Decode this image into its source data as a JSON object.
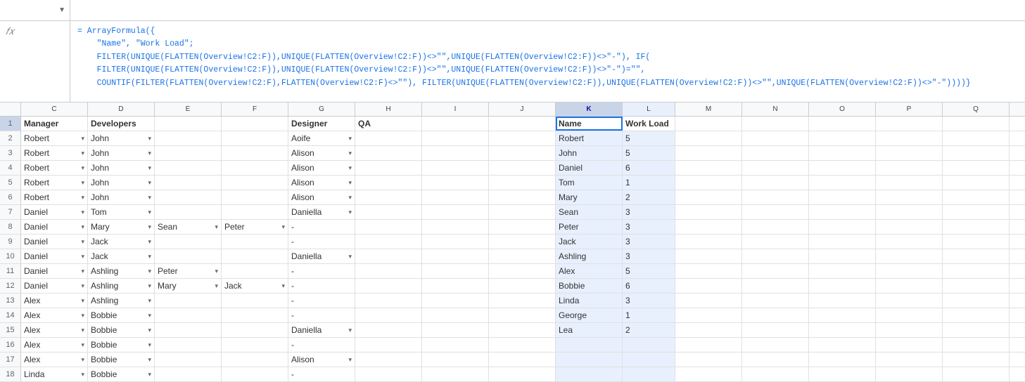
{
  "cellRef": "K1",
  "formula": "= ArrayFormula({\n    \"Name\", \"Work Load\";\n    FILTER(UNIQUE(FLATTEN(Overview!C2:F)),UNIQUE(FLATTEN(Overview!C2:F))<>\"\",UNIQUE(FLATTEN(Overview!C2:F))<>\"-\"), IF(\n    FILTER(UNIQUE(FLATTEN(Overview!C2:F)),UNIQUE(FLATTEN(Overview!C2:F))<>\"\",UNIQUE(FLATTEN(Overview!C2:F))<>\"-\")=\"\",\n    COUNTIF(FILTER(FLATTEN(Overview!C2:F),FLATTEN(Overview!C2:F)<>\"\"), FILTER(UNIQUE(FLATTEN(Overview!C2:F)),UNIQUE(FLATTEN(Overview!C2:F))<>\"\",UNIQUE(FLATTEN(Overview!C2:F))<>\"-\"))))}",
  "columns": {
    "C": "C",
    "D": "D",
    "E": "E",
    "F": "F",
    "G": "G",
    "H": "H",
    "I": "I",
    "J": "J",
    "K": "K",
    "L": "L",
    "M": "M",
    "N": "N",
    "O": "O",
    "P": "P",
    "Q": "Q"
  },
  "rows": [
    {
      "rowNum": 1,
      "c": "Manager",
      "d": "Developers",
      "e": "",
      "f": "",
      "g": "Designer",
      "h": "QA",
      "i": "",
      "j": "",
      "k": "Name",
      "l": "Work Load",
      "isHeader": true
    },
    {
      "rowNum": 2,
      "c": "Robert",
      "d": "John",
      "e": "",
      "f": "",
      "g": "Aoife",
      "h": "",
      "i": "",
      "j": "",
      "k": "Robert",
      "l": "5",
      "wlColor": "red"
    },
    {
      "rowNum": 3,
      "c": "Robert",
      "d": "John",
      "e": "",
      "f": "",
      "g": "Alison",
      "h": "",
      "i": "",
      "j": "",
      "k": "John",
      "l": "5",
      "wlColor": "red"
    },
    {
      "rowNum": 4,
      "c": "Robert",
      "d": "John",
      "e": "",
      "f": "",
      "g": "Alison",
      "h": "",
      "i": "",
      "j": "",
      "k": "Daniel",
      "l": "6",
      "wlColor": "red"
    },
    {
      "rowNum": 5,
      "c": "Robert",
      "d": "John",
      "e": "",
      "f": "",
      "g": "Alison",
      "h": "",
      "i": "",
      "j": "",
      "k": "Tom",
      "l": "1",
      "wlColor": "green"
    },
    {
      "rowNum": 6,
      "c": "Robert",
      "d": "John",
      "e": "",
      "f": "",
      "g": "Alison",
      "h": "",
      "i": "",
      "j": "",
      "k": "Mary",
      "l": "2",
      "wlColor": "light-green"
    },
    {
      "rowNum": 7,
      "c": "Daniel",
      "d": "Tom",
      "e": "",
      "f": "",
      "g": "Daniella",
      "h": "",
      "i": "",
      "j": "",
      "k": "Sean",
      "l": "3",
      "wlColor": ""
    },
    {
      "rowNum": 8,
      "c": "Daniel",
      "d": "Mary",
      "e": "Sean",
      "f": "Peter",
      "g": "-",
      "h": "",
      "i": "",
      "j": "",
      "k": "Peter",
      "l": "3",
      "wlColor": ""
    },
    {
      "rowNum": 9,
      "c": "Daniel",
      "d": "Jack",
      "e": "",
      "f": "",
      "g": "-",
      "h": "",
      "i": "",
      "j": "",
      "k": "Jack",
      "l": "3",
      "wlColor": ""
    },
    {
      "rowNum": 10,
      "c": "Daniel",
      "d": "Jack",
      "e": "",
      "f": "",
      "g": "Daniella",
      "h": "",
      "i": "",
      "j": "",
      "k": "Ashling",
      "l": "3",
      "wlColor": ""
    },
    {
      "rowNum": 11,
      "c": "Daniel",
      "d": "Ashling",
      "e": "Peter",
      "f": "",
      "g": "-",
      "h": "",
      "i": "",
      "j": "",
      "k": "Alex",
      "l": "5",
      "wlColor": "red"
    },
    {
      "rowNum": 12,
      "c": "Daniel",
      "d": "Ashling",
      "e": "Mary",
      "f": "Jack",
      "g": "-",
      "h": "",
      "i": "",
      "j": "",
      "k": "Bobbie",
      "l": "6",
      "wlColor": "red"
    },
    {
      "rowNum": 13,
      "c": "Alex",
      "d": "Ashling",
      "e": "",
      "f": "",
      "g": "-",
      "h": "",
      "i": "",
      "j": "",
      "k": "Linda",
      "l": "3",
      "wlColor": ""
    },
    {
      "rowNum": 14,
      "c": "Alex",
      "d": "Bobbie",
      "e": "",
      "f": "",
      "g": "-",
      "h": "",
      "i": "",
      "j": "",
      "k": "George",
      "l": "1",
      "wlColor": "green"
    },
    {
      "rowNum": 15,
      "c": "Alex",
      "d": "Bobbie",
      "e": "",
      "f": "",
      "g": "Daniella",
      "h": "",
      "i": "",
      "j": "",
      "k": "Lea",
      "l": "2",
      "wlColor": "light-green"
    },
    {
      "rowNum": 16,
      "c": "Alex",
      "d": "Bobbie",
      "e": "",
      "f": "",
      "g": "-",
      "h": "",
      "i": "",
      "j": "",
      "k": "",
      "l": "",
      "wlColor": ""
    },
    {
      "rowNum": 17,
      "c": "Alex",
      "d": "Bobbie",
      "e": "",
      "f": "",
      "g": "Alison",
      "h": "",
      "i": "",
      "j": "",
      "k": "",
      "l": "",
      "wlColor": ""
    },
    {
      "rowNum": 18,
      "c": "Linda",
      "d": "Bobbie",
      "e": "",
      "f": "",
      "g": "-",
      "h": "",
      "i": "",
      "j": "",
      "k": "",
      "l": "",
      "wlColor": ""
    }
  ]
}
